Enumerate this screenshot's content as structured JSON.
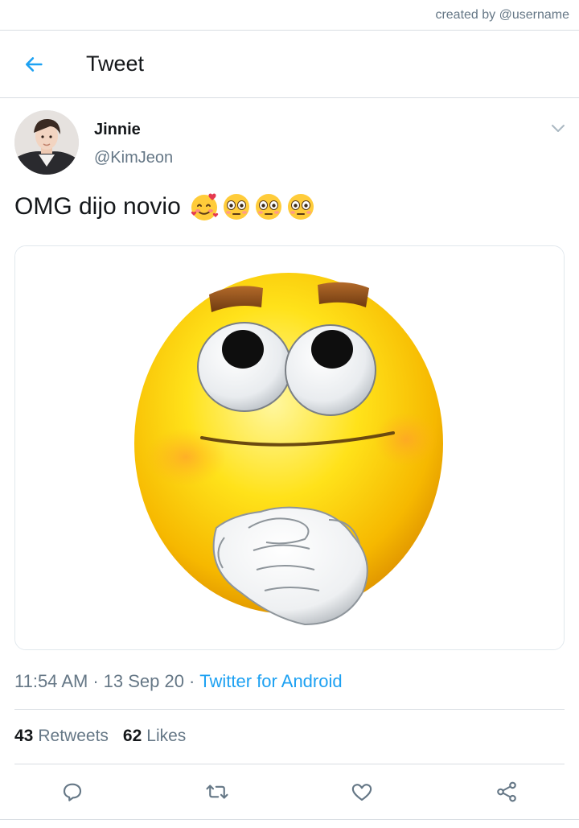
{
  "watermark": "created by @username",
  "header": {
    "title": "Tweet",
    "back_icon": "arrow-left-icon"
  },
  "author": {
    "name": "Jinnie",
    "handle": "@KimJeon"
  },
  "tweet": {
    "text": "OMG dijo novio",
    "emojis": [
      "smiling-face-with-hearts",
      "flushed-face",
      "flushed-face",
      "flushed-face"
    ]
  },
  "meta": {
    "time": "11:54 AM",
    "date": "13 Sep 20",
    "separator": "·",
    "source": "Twitter for Android"
  },
  "stats": {
    "retweets_count": "43",
    "retweets_label": "Retweets",
    "likes_count": "62",
    "likes_label": "Likes"
  },
  "actions": [
    "reply-icon",
    "retweet-icon",
    "like-icon",
    "share-icon"
  ],
  "colors": {
    "accent": "#1da1f2",
    "text": "#14171a",
    "muted": "#657786",
    "divider": "#d8dde2"
  }
}
